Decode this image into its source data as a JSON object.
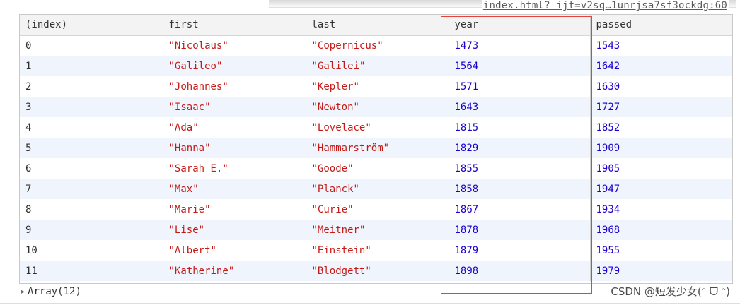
{
  "source_link": "index.html?_ijt=v2sq…1unrjsa7sf3ockdg:60",
  "table": {
    "columns": [
      "(index)",
      "first",
      "last",
      "year",
      "passed"
    ],
    "rows": [
      {
        "index": "0",
        "first": "\"Nicolaus\"",
        "last": "\"Copernicus\"",
        "year": "1473",
        "passed": "1543"
      },
      {
        "index": "1",
        "first": "\"Galileo\"",
        "last": "\"Galilei\"",
        "year": "1564",
        "passed": "1642"
      },
      {
        "index": "2",
        "first": "\"Johannes\"",
        "last": "\"Kepler\"",
        "year": "1571",
        "passed": "1630"
      },
      {
        "index": "3",
        "first": "\"Isaac\"",
        "last": "\"Newton\"",
        "year": "1643",
        "passed": "1727"
      },
      {
        "index": "4",
        "first": "\"Ada\"",
        "last": "\"Lovelace\"",
        "year": "1815",
        "passed": "1852"
      },
      {
        "index": "5",
        "first": "\"Hanna\"",
        "last": "\"Hammarström\"",
        "year": "1829",
        "passed": "1909"
      },
      {
        "index": "6",
        "first": "\"Sarah E.\"",
        "last": "\"Goode\"",
        "year": "1855",
        "passed": "1905"
      },
      {
        "index": "7",
        "first": "\"Max\"",
        "last": "\"Planck\"",
        "year": "1858",
        "passed": "1947"
      },
      {
        "index": "8",
        "first": "\"Marie\"",
        "last": "\"Curie\"",
        "year": "1867",
        "passed": "1934"
      },
      {
        "index": "9",
        "first": "\"Lise\"",
        "last": "\"Meitner\"",
        "year": "1878",
        "passed": "1968"
      },
      {
        "index": "10",
        "first": "\"Albert\"",
        "last": "\"Einstein\"",
        "year": "1879",
        "passed": "1955"
      },
      {
        "index": "11",
        "first": "\"Katherine\"",
        "last": "\"Blodgett\"",
        "year": "1898",
        "passed": "1979"
      }
    ]
  },
  "summary": {
    "triangle_icon": "▶",
    "label": "Array(12)"
  },
  "watermark": "CSDN @短发少女(ᵔ ᗜ ᵔ)",
  "colors": {
    "string": "#c41a16",
    "number": "#1c00cf",
    "highlight_box": "#e8413c",
    "stripe": "#f0f5fd"
  }
}
